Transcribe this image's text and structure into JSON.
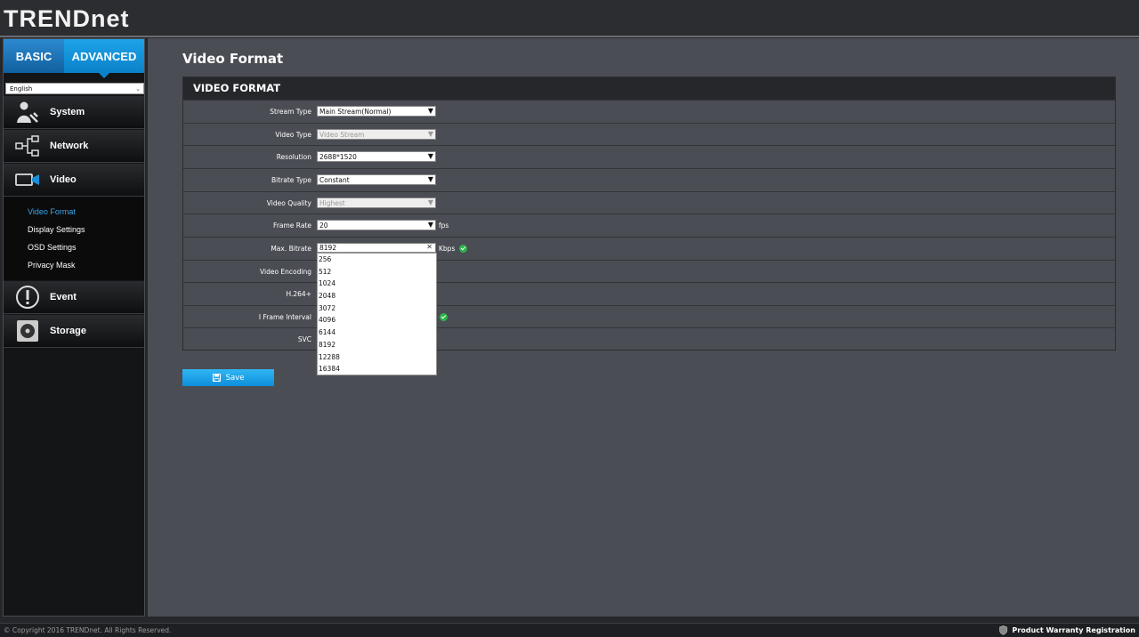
{
  "brand": {
    "logo_text": "TRENDnet"
  },
  "tabs": {
    "basic": "BASIC",
    "advanced": "ADVANCED"
  },
  "language": {
    "selected": "English"
  },
  "sidebar": {
    "items": [
      {
        "label": "System",
        "icon": "system-icon"
      },
      {
        "label": "Network",
        "icon": "network-icon"
      },
      {
        "label": "Video",
        "icon": "video-icon"
      },
      {
        "label": "Event",
        "icon": "event-icon"
      },
      {
        "label": "Storage",
        "icon": "storage-icon"
      }
    ],
    "video_submenu": [
      {
        "label": "Video Format",
        "active": true
      },
      {
        "label": "Display Settings",
        "active": false
      },
      {
        "label": "OSD Settings",
        "active": false
      },
      {
        "label": "Privacy Mask",
        "active": false
      }
    ]
  },
  "page": {
    "title": "Video Format"
  },
  "panel": {
    "header": "VIDEO FORMAT",
    "rows": {
      "stream_type": {
        "label": "Stream Type",
        "value": "Main Stream(Normal)"
      },
      "video_type": {
        "label": "Video Type",
        "value": "Video Stream"
      },
      "resolution": {
        "label": "Resolution",
        "value": "2688*1520"
      },
      "bitrate_type": {
        "label": "Bitrate Type",
        "value": "Constant"
      },
      "video_quality": {
        "label": "Video Quality",
        "value": "Highest"
      },
      "frame_rate": {
        "label": "Frame Rate",
        "value": "20",
        "unit": "fps"
      },
      "max_bitrate": {
        "label": "Max. Bitrate",
        "value": "8192",
        "unit": "Kbps"
      },
      "video_encoding": {
        "label": "Video Encoding"
      },
      "h264plus": {
        "label": "H.264+"
      },
      "i_frame_interval": {
        "label": "I Frame Interval"
      },
      "svc": {
        "label": "SVC"
      }
    }
  },
  "bitrate_options": [
    "256",
    "512",
    "1024",
    "2048",
    "3072",
    "4096",
    "6144",
    "8192",
    "12288",
    "16384"
  ],
  "buttons": {
    "save": "Save"
  },
  "footer": {
    "copyright": "© Copyright 2016 TRENDnet. All Rights Reserved.",
    "warranty": "Product Warranty Registration"
  },
  "colors": {
    "accent": "#0a82c9",
    "active_link": "#3aa7ea",
    "ok": "#2db44a"
  }
}
